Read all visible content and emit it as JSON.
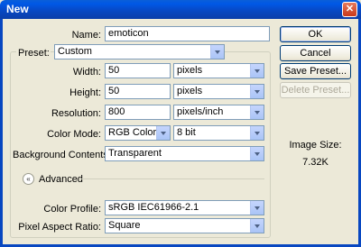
{
  "window": {
    "title": "New",
    "close_glyph": "✕"
  },
  "form": {
    "name_label": "Name:",
    "name_value": "emoticon",
    "preset_label": "Preset:",
    "preset_value": "Custom",
    "width_label": "Width:",
    "width_value": "50",
    "width_unit": "pixels",
    "height_label": "Height:",
    "height_value": "50",
    "height_unit": "pixels",
    "resolution_label": "Resolution:",
    "resolution_value": "800",
    "resolution_unit": "pixels/inch",
    "color_mode_label": "Color Mode:",
    "color_mode_value": "RGB Color",
    "bit_depth_value": "8 bit",
    "background_label": "Background Contents:",
    "background_value": "Transparent",
    "advanced_label": "Advanced",
    "advanced_icon": "«",
    "color_profile_label": "Color Profile:",
    "color_profile_value": "sRGB IEC61966-2.1",
    "pixel_aspect_label": "Pixel Aspect Ratio:",
    "pixel_aspect_value": "Square"
  },
  "buttons": {
    "ok": "OK",
    "cancel": "Cancel",
    "save_preset": "Save Preset...",
    "delete_preset": "Delete Preset..."
  },
  "image_size": {
    "label": "Image Size:",
    "value": "7.32K"
  },
  "colors": {
    "titlebar": "#0847c1",
    "dialog_bg": "#ece9d8",
    "field_border": "#7f9db9"
  }
}
